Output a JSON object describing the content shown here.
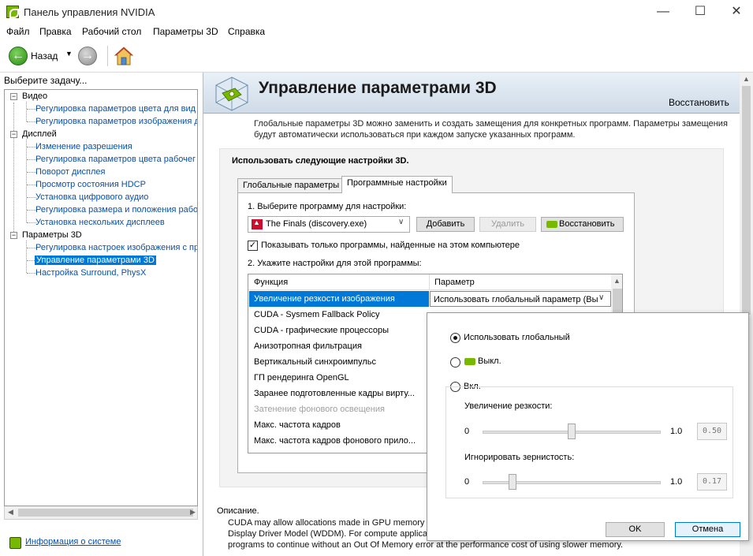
{
  "window": {
    "title": "Панель управления NVIDIA",
    "minimize_glyph": "—",
    "maximize_glyph": "☐",
    "close_glyph": "✕"
  },
  "menu": {
    "items": [
      "Файл",
      "Правка",
      "Рабочий стол",
      "Параметры 3D",
      "Справка"
    ]
  },
  "toolbar": {
    "back_label": "Назад",
    "back_glyph": "←",
    "forward_glyph": "→",
    "dropdown_glyph": "▼"
  },
  "left": {
    "header": "Выберите задачу...",
    "tree": {
      "video": {
        "label": "Видео",
        "items": [
          "Регулировка параметров цвета для вид",
          "Регулировка параметров изображения д"
        ]
      },
      "display": {
        "label": "Дисплей",
        "items": [
          "Изменение разрешения",
          "Регулировка параметров цвета рабочег",
          "Поворот дисплея",
          "Просмотр состояния HDCP",
          "Установка цифрового аудио",
          "Регулировка размера и положения рабоч",
          "Установка нескольких дисплеев"
        ]
      },
      "params3d": {
        "label": "Параметры 3D",
        "items": [
          "Регулировка настроек изображения с пр",
          "Управление параметрами 3D",
          "Настройка Surround, PhysX"
        ]
      },
      "expander_glyph": "−"
    },
    "sysinfo_link": "Информация о системе"
  },
  "main": {
    "title": "Управление параметрами 3D",
    "restore_link": "Восстановить",
    "intro": "Глобальные параметры 3D можно заменить и создать замещения для конкретных программ. Параметры замещения будут автоматически использоваться при каждом запуске указанных программ.",
    "settings_heading": "Использовать следующие настройки 3D.",
    "tabs": [
      "Глобальные параметры",
      "Программные настройки"
    ],
    "step1": "1. Выберите программу для настройки:",
    "program_selected": "The Finals (discovery.exe)",
    "add_button": "Добавить",
    "remove_button": "Удалить",
    "restore_button": "Восстановить",
    "show_only_label": "Показывать только программы, найденные на этом компьютере",
    "show_only_check": "✓",
    "step2": "2. Укажите настройки для этой программы:",
    "table": {
      "col_function": "Функция",
      "col_param": "Параметр",
      "rows": [
        "Увеличение резкости изображения",
        "CUDA - Sysmem Fallback Policy",
        "CUDA - графические процессоры",
        "Анизотропная фильтрация",
        "Вертикальный синхроимпульс",
        "ГП рендеринга OpenGL",
        "Заранее подготовленные кадры вирту...",
        "Затенение фонового освещения",
        "Макс. частота кадров",
        "Макс. частота кадров фонового прило..."
      ],
      "selected_param": "Использовать глобальный параметр (Вы",
      "chevron": "∨"
    },
    "description_label": "Описание.",
    "description": "CUDA may allow allocations made in GPU memory to fallback to system memory when the GPU is running with the Windows Display Driver Model (WDDM). For compute applications this allows the allocations to fallback to system memory to allow programs to continue without an Out Of Memory error at the performance cost of using slower memory."
  },
  "popup": {
    "radio_global": "Использовать глобальный",
    "radio_off": "Выкл.",
    "radio_on": "Вкл.",
    "sharpen_label": "Увеличение резкости:",
    "sharpen_min": "0",
    "sharpen_max": "1.0",
    "sharpen_value": "0.50",
    "sharpen_level": 0.5,
    "grain_label": "Игнорировать зернистость:",
    "grain_min": "0",
    "grain_max": "1.0",
    "grain_value": "0.17",
    "grain_level": 0.17,
    "ok": "OK",
    "cancel": "Отмена"
  },
  "colors": {
    "nvidia_green": "#76b900",
    "selection_blue": "#0078d7",
    "link_blue": "#0a4fa8"
  }
}
